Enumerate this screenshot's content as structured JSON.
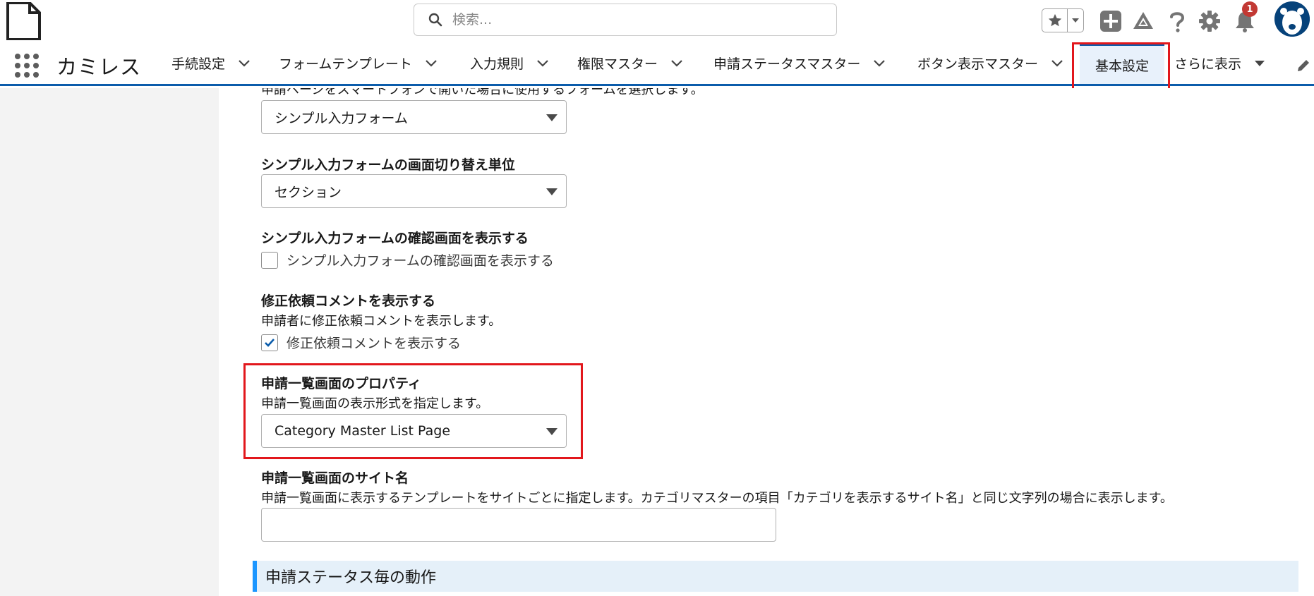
{
  "header": {
    "search_placeholder": "検索...",
    "notification_count": "1"
  },
  "nav": {
    "app_name": "カミレス",
    "tabs": [
      {
        "label": "手続設定"
      },
      {
        "label": "フォームテンプレート"
      },
      {
        "label": "入力規則"
      },
      {
        "label": "権限マスター"
      },
      {
        "label": "申請ステータスマスター"
      },
      {
        "label": "ボタン表示マスター"
      },
      {
        "label": "基本設定",
        "active": true
      },
      {
        "label": "さらに表示"
      }
    ]
  },
  "form": {
    "cut_text": "申請ページをスマートフォンで開いた場合に使用するフォームを選択します。",
    "smartphone_form_value": "シンプル入力フォーム",
    "switch_unit": {
      "label": "シンプル入力フォームの画面切り替え単位",
      "value": "セクション"
    },
    "confirm_screen": {
      "label": "シンプル入力フォームの確認画面を表示する",
      "checkbox_label": "シンプル入力フォームの確認画面を表示する",
      "checked": false
    },
    "revision_comment": {
      "label": "修正依頼コメントを表示する",
      "help": "申請者に修正依頼コメントを表示します。",
      "checkbox_label": "修正依頼コメントを表示する",
      "checked": true
    },
    "list_property": {
      "label": "申請一覧画面のプロパティ",
      "help": "申請一覧画面の表示形式を指定します。",
      "value": "Category Master List Page"
    },
    "site_name": {
      "label": "申請一覧画面のサイト名",
      "help": "申請一覧画面に表示するテンプレートをサイトごとに指定します。カテゴリマスターの項目「カテゴリを表示するサイト名」と同じ文字列の場合に表示します。",
      "value": ""
    }
  },
  "section": {
    "title": "申請ステータス毎の動作"
  },
  "colors": {
    "brand_blue": "#0b5cab",
    "highlight_red": "#e2171c",
    "section_bg": "#e5f0f9",
    "badge_red": "#c23934"
  }
}
